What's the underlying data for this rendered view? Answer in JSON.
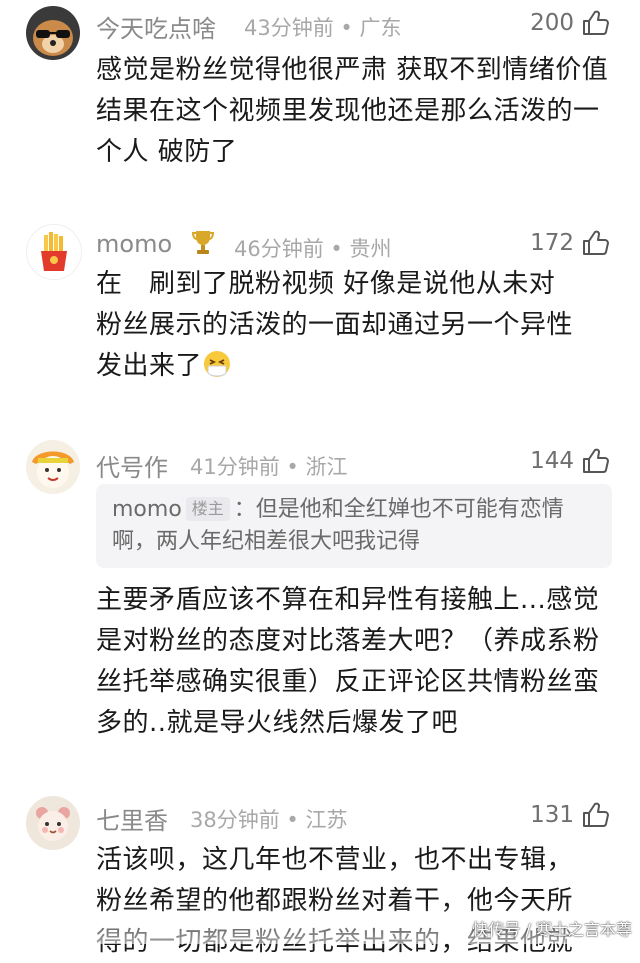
{
  "colors": {
    "meta": "#a8a8a8",
    "username": "#8a8a8a",
    "text": "#1a1a1a",
    "quote_bg": "#f4f4f6"
  },
  "comments": [
    {
      "username": "今天吃点啥",
      "time": "43分钟前",
      "location": "广东",
      "likes": "200",
      "text": "感觉是粉丝觉得他很严肃 获取不到情绪价值 结果在这个视频里发现他还是那么活泼的一个人 破防了",
      "avatar_icon": "dog-with-sunglasses-avatar"
    },
    {
      "username": "momo",
      "time": "46分钟前",
      "location": "贵州",
      "likes": "172",
      "text_line1": "在　刷到了脱粉视频 好像是说他从未对",
      "text_line2": "粉丝展示的活泼的一面却通过另一个异性",
      "text_line3": "发出来了",
      "badge_icon": "trophy-icon",
      "emoji_icon": "sneeze-emoji-icon",
      "avatar_icon": "fries-avatar"
    },
    {
      "username": "代号作",
      "time": "41分钟前",
      "location": "浙江",
      "likes": "144",
      "quote_user": "momo",
      "quote_tag": "楼主",
      "quote_text_line1": "：但是他和全红婵也不可能有恋情",
      "quote_text_line2": "啊，两人年纪相差很大吧我记得",
      "text": "主要矛盾应该不算在和异性有接触上...感觉是对粉丝的态度对比落差大吧？（养成系粉丝托举感确实很重）反正评论区共情粉丝蛮多的..就是导火线然后爆发了吧",
      "avatar_icon": "cartoon-character-avatar"
    },
    {
      "username": "七里香",
      "time": "38分钟前",
      "location": "江苏",
      "likes": "131",
      "text_line1": "活该呗，这几年也不营业，也不出专辑，",
      "text_line2": "粉丝希望的他都跟粉丝对着干，他今天所",
      "text_line3": "得的一切都是粉丝托举出来的，结果他就",
      "avatar_icon": "cartoon-bear-avatar"
    }
  ],
  "watermark": "快传号 / 寒士之言本尊"
}
